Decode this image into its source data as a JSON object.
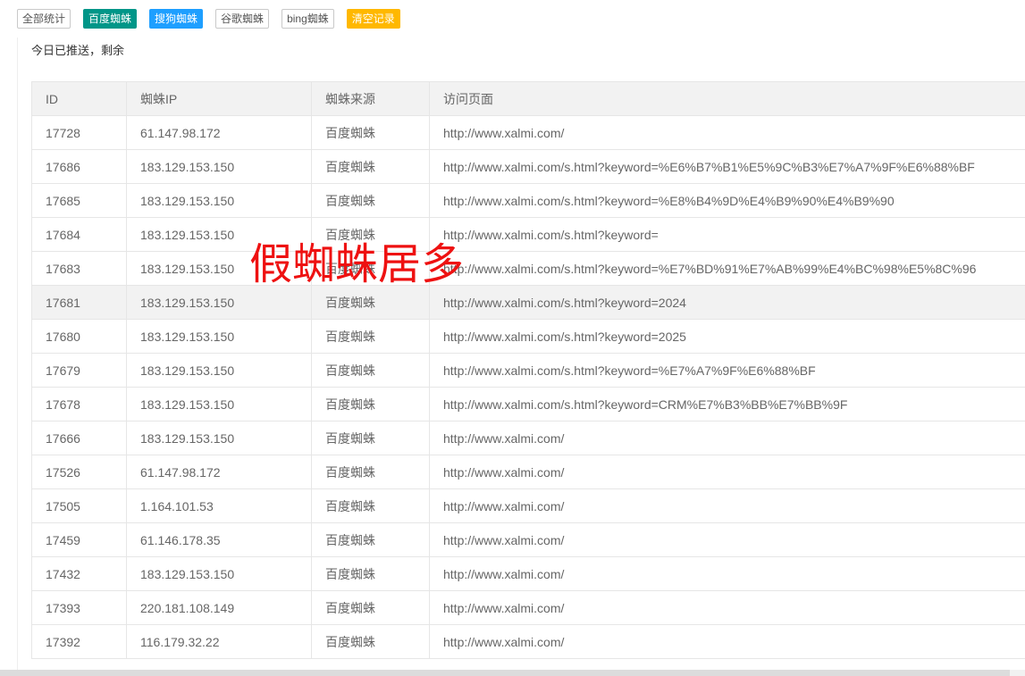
{
  "toolbar": {
    "buttons": [
      {
        "label": "全部统计",
        "style": "default"
      },
      {
        "label": "百度蜘蛛",
        "style": "green"
      },
      {
        "label": "搜狗蜘蛛",
        "style": "blue"
      },
      {
        "label": "谷歌蜘蛛",
        "style": "default"
      },
      {
        "label": "bing蜘蛛",
        "style": "default"
      },
      {
        "label": "清空记录",
        "style": "orange"
      }
    ]
  },
  "notice": "今日已推送，剩余",
  "overlay_text": "假蜘蛛居多",
  "table": {
    "headers": [
      "ID",
      "蜘蛛IP",
      "蜘蛛来源",
      "访问页面"
    ],
    "rows": [
      [
        "17728",
        "61.147.98.172",
        "百度蜘蛛",
        "http://www.xalmi.com/"
      ],
      [
        "17686",
        "183.129.153.150",
        "百度蜘蛛",
        "http://www.xalmi.com/s.html?keyword=%E6%B7%B1%E5%9C%B3%E7%A7%9F%E6%88%BF"
      ],
      [
        "17685",
        "183.129.153.150",
        "百度蜘蛛",
        "http://www.xalmi.com/s.html?keyword=%E8%B4%9D%E4%B9%90%E4%B9%90"
      ],
      [
        "17684",
        "183.129.153.150",
        "百度蜘蛛",
        "http://www.xalmi.com/s.html?keyword="
      ],
      [
        "17683",
        "183.129.153.150",
        "百度蜘蛛",
        "http://www.xalmi.com/s.html?keyword=%E7%BD%91%E7%AB%99%E4%BC%98%E5%8C%96"
      ],
      [
        "17681",
        "183.129.153.150",
        "百度蜘蛛",
        "http://www.xalmi.com/s.html?keyword=2024"
      ],
      [
        "17680",
        "183.129.153.150",
        "百度蜘蛛",
        "http://www.xalmi.com/s.html?keyword=2025"
      ],
      [
        "17679",
        "183.129.153.150",
        "百度蜘蛛",
        "http://www.xalmi.com/s.html?keyword=%E7%A7%9F%E6%88%BF"
      ],
      [
        "17678",
        "183.129.153.150",
        "百度蜘蛛",
        "http://www.xalmi.com/s.html?keyword=CRM%E7%B3%BB%E7%BB%9F"
      ],
      [
        "17666",
        "183.129.153.150",
        "百度蜘蛛",
        "http://www.xalmi.com/"
      ],
      [
        "17526",
        "61.147.98.172",
        "百度蜘蛛",
        "http://www.xalmi.com/"
      ],
      [
        "17505",
        "1.164.101.53",
        "百度蜘蛛",
        "http://www.xalmi.com/"
      ],
      [
        "17459",
        "61.146.178.35",
        "百度蜘蛛",
        "http://www.xalmi.com/"
      ],
      [
        "17432",
        "183.129.153.150",
        "百度蜘蛛",
        "http://www.xalmi.com/"
      ],
      [
        "17393",
        "220.181.108.149",
        "百度蜘蛛",
        "http://www.xalmi.com/"
      ],
      [
        "17392",
        "116.179.32.22",
        "百度蜘蛛",
        "http://www.xalmi.com/"
      ]
    ],
    "hovered_row_index": 5
  },
  "colors": {
    "green": "#009688",
    "blue": "#1E9FFF",
    "orange": "#FFB800",
    "overlay_red": "#ee1111",
    "header_bg": "#f2f2f2"
  }
}
